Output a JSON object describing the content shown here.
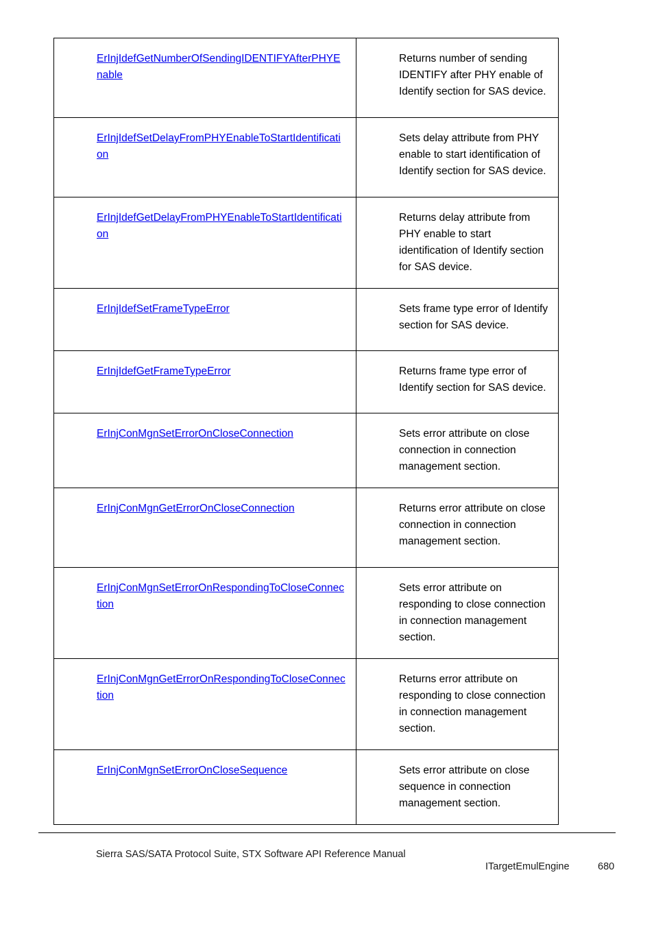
{
  "document": {
    "footer_left": "Sierra SAS/SATA Protocol Suite, STX Software API Reference Manual",
    "footer_section": "ITargetEmulEngine",
    "page_number": "680",
    "link_color": "#0000EE",
    "text_color": "#000000",
    "border_color": "#000000",
    "background_color": "#FFFFFF"
  },
  "api_table": {
    "rows": [
      {
        "name": "ErInjIdefGetNumberOfSendingIDENTIFYAfterPHYEnable",
        "description": "Returns number of sending IDENTIFY after PHY enable of Identify section for SAS device."
      },
      {
        "name": "ErInjIdefSetDelayFromPHYEnableToStartIdentification",
        "description": "Sets delay attribute from PHY enable to start identification of Identify section for SAS device."
      },
      {
        "name": "ErInjIdefGetDelayFromPHYEnableToStartIdentification",
        "description": "Returns delay attribute from PHY enable to start identification of Identify section for SAS device."
      },
      {
        "name": "ErInjIdefSetFrameTypeError",
        "description": "Sets frame type error of Identify section for SAS device."
      },
      {
        "name": "ErInjIdefGetFrameTypeError",
        "description": "Returns frame type error of Identify section for SAS device."
      },
      {
        "name": "ErInjConMgnSetErrorOnCloseConnection",
        "description": "Sets error attribute on close connection in connection management section."
      },
      {
        "name": "ErInjConMgnGetErrorOnCloseConnection",
        "description": "Returns error attribute on close connection in connection management section."
      },
      {
        "name": "ErInjConMgnSetErrorOnRespondingToCloseConnection",
        "description": "Sets error attribute on responding to close connection in connection management section."
      },
      {
        "name": "ErInjConMgnGetErrorOnRespondingToCloseConnection",
        "description": "Returns error attribute on responding to close connection in connection management section."
      },
      {
        "name": "ErInjConMgnSetErrorOnCloseSequence",
        "description": "Sets error attribute on close sequence in connection management section."
      }
    ]
  }
}
